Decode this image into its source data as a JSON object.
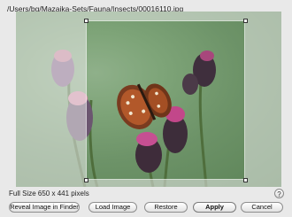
{
  "window": {
    "path": "/Users/bg/Mazaika-Sets/Fauna/Insects/00016110.jpg"
  },
  "image": {
    "subject": "butterfly on thistle flowers",
    "size_label": "Full Size 650 x 441 pixels"
  },
  "buttons": {
    "reveal": "Reveal Image in Finder",
    "load": "Load Image",
    "restore": "Restore",
    "apply": "Apply",
    "cancel": "Cancel"
  },
  "help": {
    "label": "?"
  },
  "colors": {
    "background": "#e9e9e9",
    "photo_green": "#7ea478",
    "thistle_purple": "#b0427a"
  }
}
